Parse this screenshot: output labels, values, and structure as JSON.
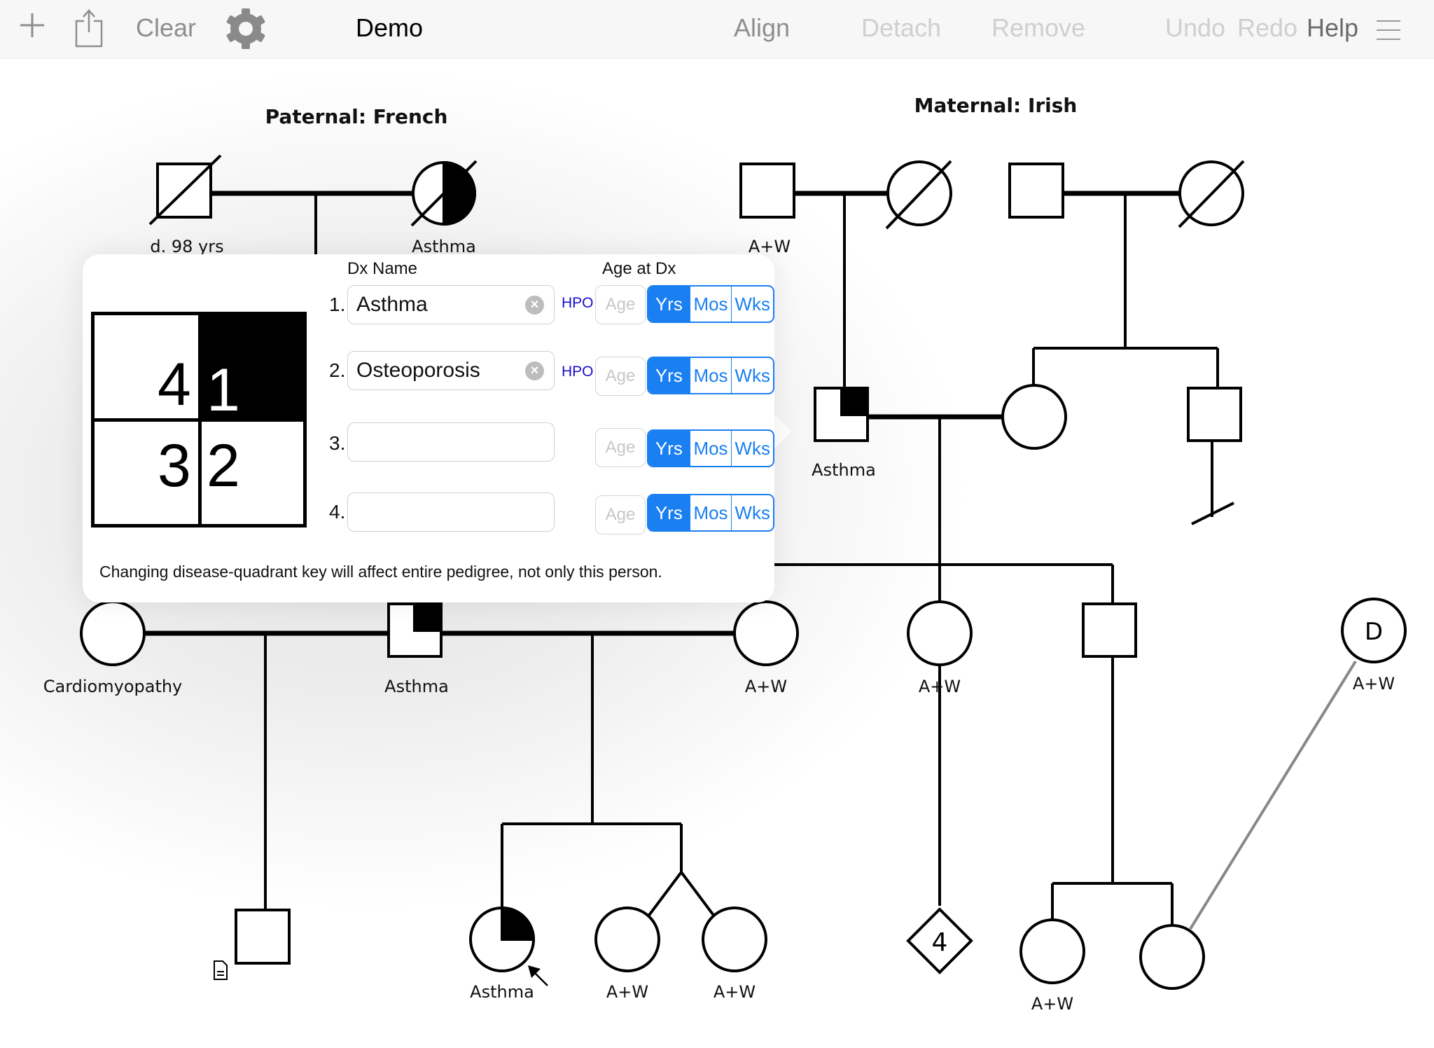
{
  "toolbar": {
    "add_icon": "plus-icon",
    "share_icon": "share-icon",
    "clear_label": "Clear",
    "settings_icon": "gear-icon",
    "title": "Demo",
    "align_label": "Align",
    "detach_label": "Detach",
    "remove_label": "Remove",
    "undo_label": "Undo",
    "redo_label": "Redo",
    "help_label": "Help",
    "menu_icon": "hamburger-menu-icon"
  },
  "pedigree": {
    "paternal_title": "Paternal: French",
    "maternal_title": "Maternal: Irish",
    "labels": {
      "paternal_grandfather": "d. 98 yrs",
      "paternal_grandmother": "Asthma",
      "maternal_grandfather": "A+W",
      "father": "Asthma",
      "aunt_left": "Cardiomyopathy",
      "proband_parent": "Asthma",
      "aunt_right": "A+W",
      "sibling_female": "A+W",
      "donor": "A+W",
      "donor_symbol": "D",
      "child_affected": "Asthma",
      "twin_1": "A+W",
      "twin_2": "A+W",
      "multiple_count": "4",
      "grandchild_1": "A+W"
    },
    "colors": {
      "line": "#000000",
      "donor_line": "#888888"
    }
  },
  "popover": {
    "dx_name_header": "Dx Name",
    "age_header": "Age at Dx",
    "quadrant_key": {
      "top_left": "4",
      "top_right": "1",
      "bottom_left": "3",
      "bottom_right": "2",
      "filled_quadrant": "1"
    },
    "rows": [
      {
        "num": "1.",
        "value": "Asthma",
        "hpo": "HPO",
        "age_placeholder": "Age",
        "units": [
          "Yrs",
          "Mos",
          "Wks"
        ],
        "selected_unit": "Yrs"
      },
      {
        "num": "2.",
        "value": "Osteoporosis",
        "hpo": "HPO",
        "age_placeholder": "Age",
        "units": [
          "Yrs",
          "Mos",
          "Wks"
        ],
        "selected_unit": "Yrs"
      },
      {
        "num": "3.",
        "value": "",
        "hpo": "",
        "age_placeholder": "Age",
        "units": [
          "Yrs",
          "Mos",
          "Wks"
        ],
        "selected_unit": "Yrs"
      },
      {
        "num": "4.",
        "value": "",
        "hpo": "",
        "age_placeholder": "Age",
        "units": [
          "Yrs",
          "Mos",
          "Wks"
        ],
        "selected_unit": "Yrs"
      }
    ],
    "note": "Changing disease-quadrant key will affect entire pedigree, not only this person.",
    "accent_color": "#1a7ff0",
    "hpo_color": "#1a0dcc"
  }
}
